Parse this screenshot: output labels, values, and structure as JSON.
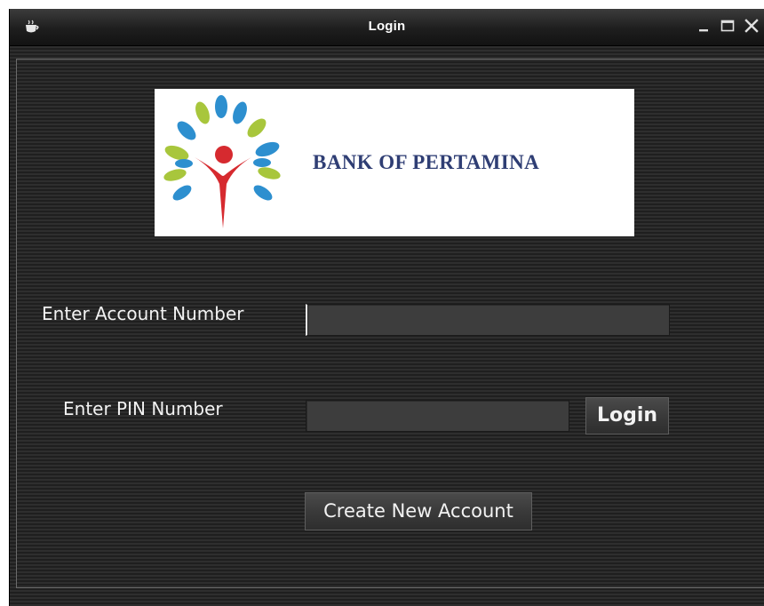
{
  "window": {
    "title": "Login",
    "controls": {
      "minimize_icon": "minimize-icon",
      "maximize_icon": "maximize-icon",
      "close_icon": "close-icon"
    }
  },
  "logo": {
    "bank_name": "BANK OF PERTAMINA"
  },
  "form": {
    "account_label": "Enter Account Number",
    "account_value": "",
    "pin_label": "Enter PIN Number",
    "pin_value": "",
    "login_label": "Login",
    "create_label": "Create New Account"
  },
  "colors": {
    "background": "#2b2b2b",
    "input_bg": "#3d3d3d",
    "text": "#f2f2f2",
    "bank_name": "#2f3e74",
    "logo_blue": "#2d8fcf",
    "logo_green": "#a8c63c",
    "logo_red": "#d62a2f"
  }
}
